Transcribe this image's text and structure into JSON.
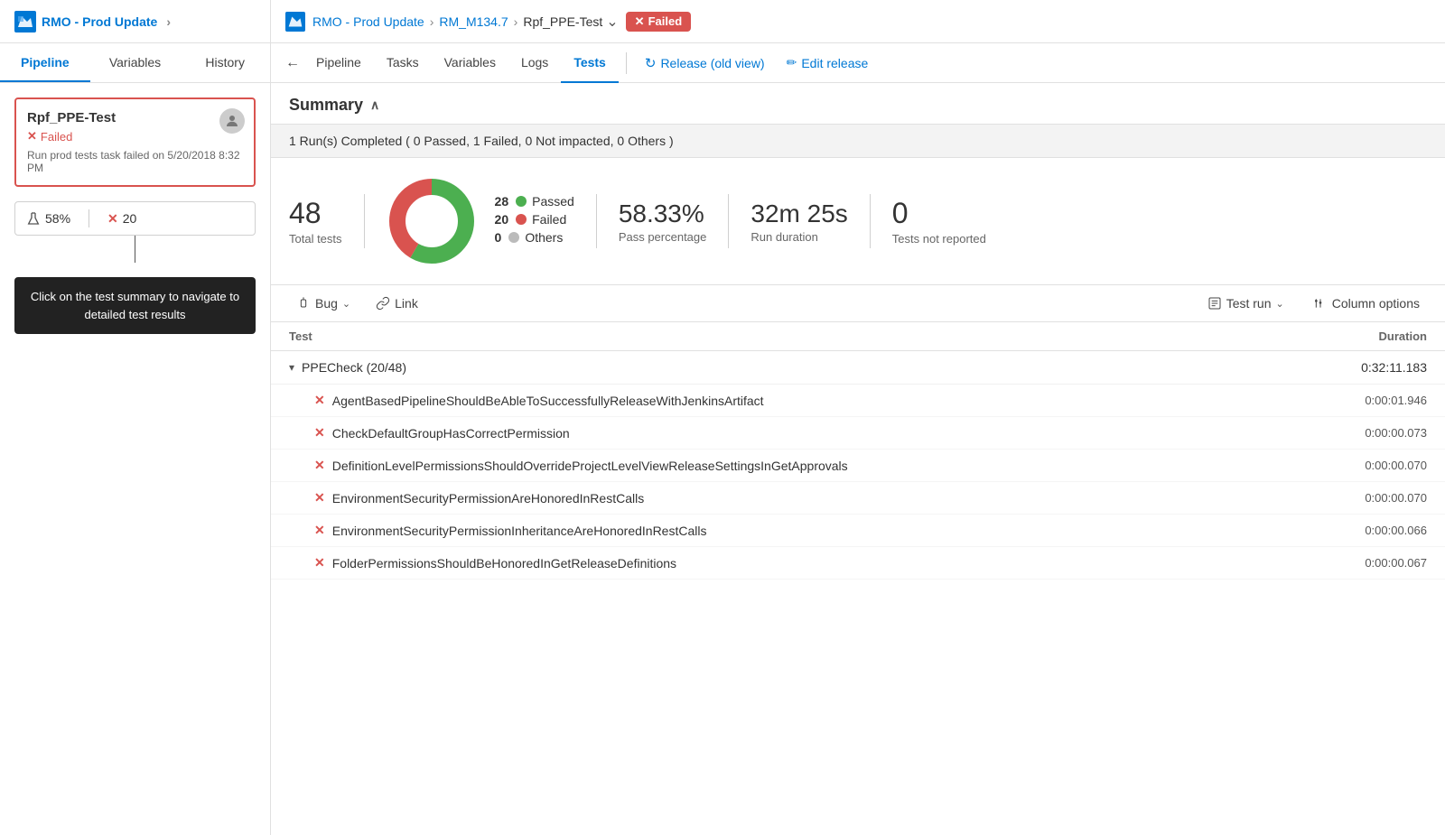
{
  "app": {
    "logo_icon": "▲",
    "left_project": "RMO - Prod Update",
    "left_sep": ">",
    "breadcrumb": {
      "project": "RMO - Prod Update",
      "release": "RM_M134.7",
      "stage": "Rpf_PPE-Test",
      "status": "Failed"
    }
  },
  "left_tabs": [
    {
      "label": "Pipeline",
      "active": true
    },
    {
      "label": "Variables",
      "active": false
    },
    {
      "label": "History",
      "active": false
    }
  ],
  "pipeline_item": {
    "title": "Rpf_PPE-Test",
    "status": "Failed",
    "description": "Run prod tests task failed on 5/20/2018 8:32 PM",
    "pass_pct": "58%",
    "fail_count": "20"
  },
  "tooltip": {
    "text": "Click on the test summary to navigate to detailed test results"
  },
  "nav_tabs": [
    {
      "label": "Pipeline",
      "icon": "←",
      "back": true
    },
    {
      "label": "Tasks"
    },
    {
      "label": "Variables"
    },
    {
      "label": "Logs"
    },
    {
      "label": "Tests",
      "active": true
    }
  ],
  "nav_actions": [
    {
      "label": "Release (old view)",
      "icon": "↻"
    },
    {
      "label": "Edit release",
      "icon": "✏"
    }
  ],
  "summary": {
    "title": "Summary",
    "run_summary": "1 Run(s) Completed ( 0 Passed, 1 Failed, 0 Not impacted, 0 Others )",
    "total_tests": "48",
    "total_label": "Total tests",
    "donut": {
      "passed": 28,
      "failed": 20,
      "others": 0,
      "total": 48
    },
    "legend": [
      {
        "label": "Passed",
        "count": "28",
        "color": "#4caf50"
      },
      {
        "label": "Failed",
        "count": "20",
        "color": "#d9534f"
      },
      {
        "label": "Others",
        "count": "0",
        "color": "#bbb"
      }
    ],
    "pass_pct": "58.33%",
    "pass_pct_label": "Pass percentage",
    "run_duration": "32m 25s",
    "run_duration_label": "Run duration",
    "not_reported": "0",
    "not_reported_label": "Tests not reported"
  },
  "toolbar": {
    "bug_label": "Bug",
    "link_label": "Link",
    "test_run_label": "Test run",
    "column_label": "Column options"
  },
  "table": {
    "col_test": "Test",
    "col_duration": "Duration",
    "group": {
      "name": "PPECheck (20/48)",
      "duration": "0:32:11.183"
    },
    "rows": [
      {
        "name": "AgentBasedPipelineShouldBeAbleToSuccessfullyReleaseWithJenkinsArtifact",
        "duration": "0:00:01.946",
        "status": "fail"
      },
      {
        "name": "CheckDefaultGroupHasCorrectPermission",
        "duration": "0:00:00.073",
        "status": "fail"
      },
      {
        "name": "DefinitionLevelPermissionsShouldOverrideProjectLevelViewReleaseSettingsInGetApprovals",
        "duration": "0:00:00.070",
        "status": "fail"
      },
      {
        "name": "EnvironmentSecurityPermissionAreHonoredInRestCalls",
        "duration": "0:00:00.070",
        "status": "fail"
      },
      {
        "name": "EnvironmentSecurityPermissionInheritanceAreHonoredInRestCalls",
        "duration": "0:00:00.066",
        "status": "fail"
      },
      {
        "name": "FolderPermissionsShouldBeHonoredInGetReleaseDefinitions",
        "duration": "0:00:00.067",
        "status": "fail"
      }
    ]
  }
}
